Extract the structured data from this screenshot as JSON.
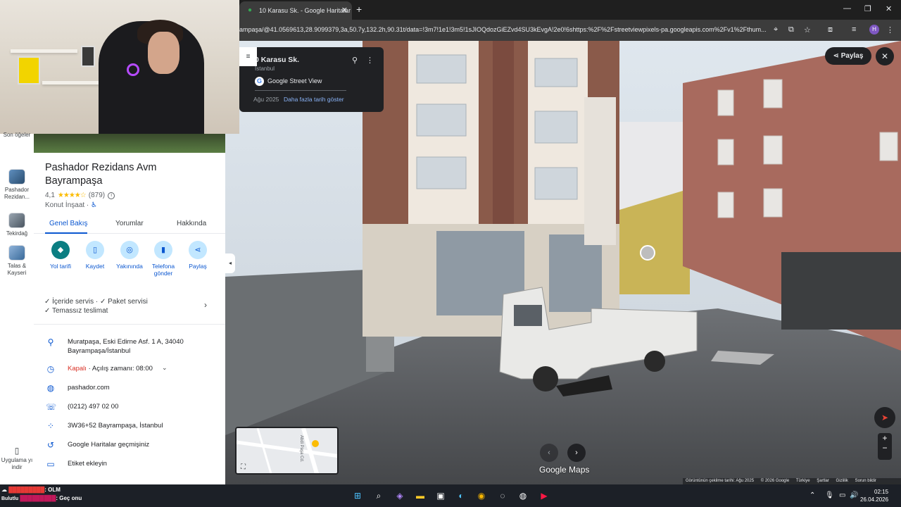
{
  "browser": {
    "tab_title": "10 Karasu Sk. - Google Haritalar",
    "url": "ampaşa/@41.0569613,28.9099379,3a,50.7y,132.2h,90.31t/data=!3m7!1e1!3m5!1sJIOQdozGiEZvd4SU3kEvgA!2e0!6shttps:%2F%2Fstreetviewpixels-pa.googleapis.com%2Fv1%2Fthum...",
    "profile_initial": "H"
  },
  "rail": {
    "items": [
      {
        "label": "Son öğeler"
      },
      {
        "label": "Pashador Rezidan..."
      },
      {
        "label": "Tekirdağ"
      },
      {
        "label": "Talas & Kayseri"
      },
      {
        "label": "Uygulama yı indir"
      }
    ]
  },
  "place": {
    "title": "Pashador Rezidans Avm Bayrampaşa",
    "rating": "4,1",
    "stars": "★★★★☆",
    "reviews": "(879)",
    "category": "Konut İnşaat ·",
    "tabs": [
      "Genel Bakış",
      "Yorumlar",
      "Hakkında"
    ],
    "actions": [
      "Yol tarifi",
      "Kaydet",
      "Yakınında",
      "Telefona gönder",
      "Paylaş"
    ],
    "features_line1": "✓ İçeride servis · ✓ Paket servisi",
    "features_line2": "✓ Temassız teslimat",
    "address_line1": "Muratpaşa, Eski Edirne Asf. 1 A, 34040",
    "address_line2": "Bayrampaşa/İstanbul",
    "hours_status": "Kapalı",
    "hours_text": " · Açılış zamanı: 08:00",
    "website": "pashador.com",
    "phone": "(0212) 497 02 00",
    "plus_code": "3W36+52 Bayrampaşa, İstanbul",
    "history": "Google Haritalar geçmişiniz",
    "label_add": "Etiket ekleyin"
  },
  "streetview": {
    "title": "0 Karasu Sk.",
    "city": "İstanbul",
    "provider": "Google Street View",
    "date": "Ağu 2025",
    "more_dates": "Daha fazla tarih göster",
    "share": "Paylaş",
    "logo": "Google Maps",
    "footer": [
      "Görüntünün çekilme tarihi: Ağu 2025",
      "© 2026 Google",
      "Türkiye",
      "Şartlar",
      "Gizlilik",
      "Sorun bildir"
    ],
    "minimap_street": "Abdi Paşa Cd."
  },
  "chat": [
    {
      "name": "█████████",
      "msg": ": OLM"
    },
    {
      "name": "█████████",
      "msg": ": Geç onu"
    }
  ],
  "taskbar": {
    "time": "02:15",
    "date": "26.04.2026",
    "weather": "Bulutlu"
  },
  "colors": {
    "accent": "#0b57d0",
    "primary_action": "#0b7e82",
    "closed": "#d93025"
  }
}
